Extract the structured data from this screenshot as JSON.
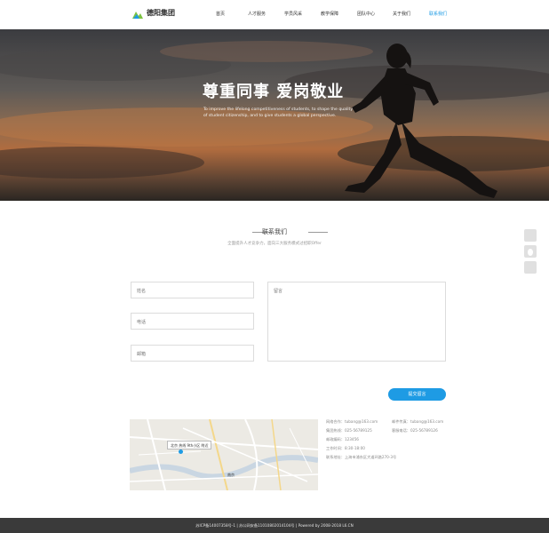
{
  "header": {
    "logo_text": "德阳集团",
    "nav": [
      {
        "label": "首页"
      },
      {
        "label": "人才服务"
      },
      {
        "label": "学员风采"
      },
      {
        "label": "教学保障"
      },
      {
        "label": "团队中心"
      },
      {
        "label": "关于我们"
      },
      {
        "label": "联系我们",
        "active": true
      }
    ]
  },
  "banner": {
    "title": "尊重同事 爱岗敬业",
    "subtitle": "To improve the lifelong competitiveness of students, to shape the quality of student citizenship, and to give students a global perspective."
  },
  "contact": {
    "title": "联系我们",
    "subtitle": "全面提升人才竞争力，面向三大服务模式过招职Offer",
    "form": {
      "name_placeholder": "姓名",
      "phone_placeholder": "电话",
      "email_placeholder": "邮箱",
      "message_placeholder": "留言",
      "submit_label": "提交留言"
    }
  },
  "map": {
    "tooltip": "北京 热线 9th小区  附近",
    "city_label": "南京"
  },
  "info": {
    "left": [
      "网络合作：tubang@163.com",
      "集团热线：025-56789125",
      "邮政编码：123456",
      "工作时间：8:30-18:00",
      "联系地址：上海市浦东区大道环路270-3号"
    ],
    "right": [
      "邮件传真：tubang@163.com",
      "客服电话：025-56789126"
    ]
  },
  "footer": {
    "text": "苏ICP备14007358号-1 | 苏公网安备11010802014104号 | Powered by 2008-2018 L6.CN"
  },
  "colors": {
    "accent": "#1e9be4",
    "footer_bg": "#3a3a3a"
  },
  "icons": [
    "logo-mark-icon",
    "map-pin-icon",
    "service-tool-icon",
    "qq-tool-icon",
    "wechat-tool-icon"
  ]
}
